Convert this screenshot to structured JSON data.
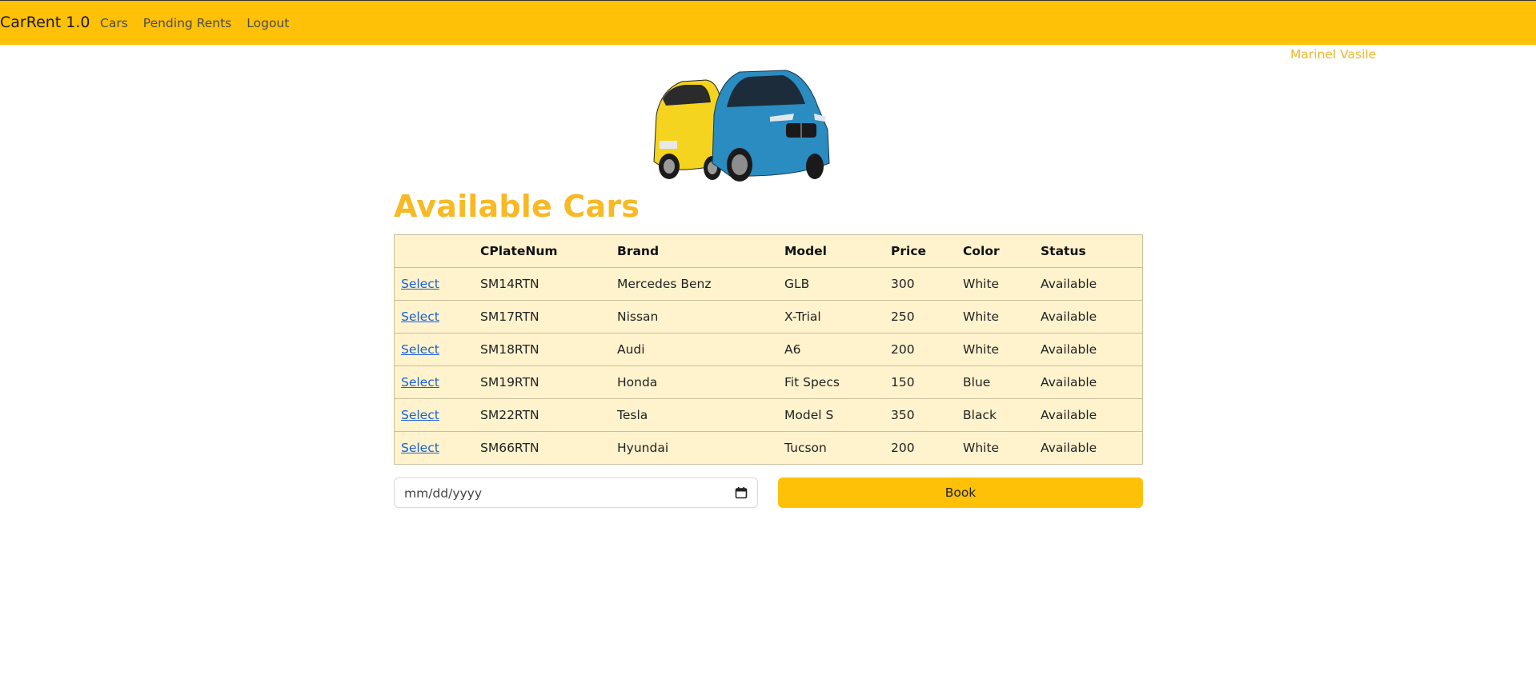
{
  "navbar": {
    "brand": "CarRent 1.0",
    "links": [
      "Cars",
      "Pending Rents",
      "Logout"
    ],
    "background_color": "#ffc107"
  },
  "user": {
    "name": "Marinel Vasile"
  },
  "main": {
    "title": "Available Cars",
    "table": {
      "headers": [
        "",
        "CPlateNum",
        "Brand",
        "Model",
        "Price",
        "Color",
        "Status"
      ],
      "rows": [
        [
          "Select",
          "SM14RTN",
          "Mercedes Benz",
          "GLB",
          "300",
          "White",
          "Available"
        ],
        [
          "Select",
          "SM17RTN",
          "Nissan",
          "X-Trial",
          "250",
          "White",
          "Available"
        ],
        [
          "Select",
          "SM18RTN",
          "Audi",
          "A6",
          "200",
          "White",
          "Available"
        ],
        [
          "Select",
          "SM19RTN",
          "Honda",
          "Fit Specs",
          "150",
          "Blue",
          "Available"
        ],
        [
          "Select",
          "SM22RTN",
          "Tesla",
          "Model S",
          "350",
          "Black",
          "Available"
        ],
        [
          "Select",
          "SM66RTN",
          "Hyundai",
          "Tucson",
          "200",
          "White",
          "Available"
        ]
      ]
    },
    "date_input": {
      "placeholder": "mm/dd/yyyy",
      "icon": "calendar-icon"
    },
    "book_button": {
      "label": "Book",
      "color": "#ffc107"
    }
  },
  "colors": {
    "accent": "#f7b924",
    "link": "#1a5fd6",
    "table_bg": "#fff3cd"
  }
}
